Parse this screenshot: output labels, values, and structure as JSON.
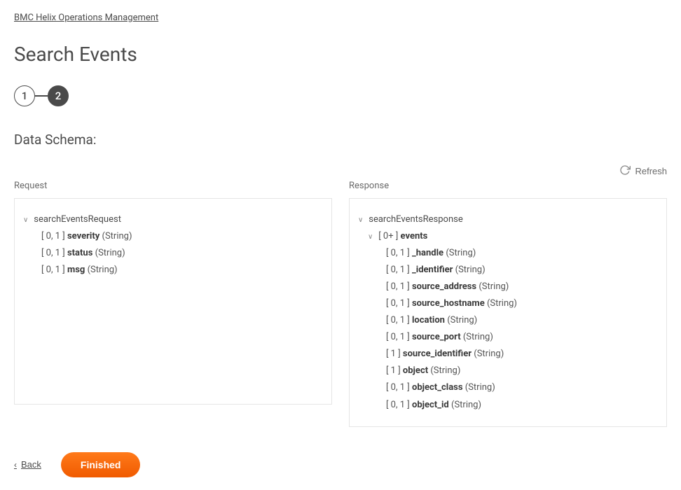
{
  "breadcrumb": "BMC Helix Operations Management",
  "page_title": "Search Events",
  "stepper": {
    "step1": "1",
    "step2": "2"
  },
  "section_heading": "Data Schema:",
  "refresh_label": "Refresh",
  "columns": {
    "request": {
      "label": "Request",
      "root": "searchEventsRequest",
      "fields": [
        {
          "card": "[ 0, 1 ]",
          "name": "severity",
          "type": "(String)"
        },
        {
          "card": "[ 0, 1 ]",
          "name": "status",
          "type": "(String)"
        },
        {
          "card": "[ 0, 1 ]",
          "name": "msg",
          "type": "(String)"
        }
      ]
    },
    "response": {
      "label": "Response",
      "root": "searchEventsResponse",
      "events_card": "[ 0+ ]",
      "events_name": "events",
      "fields": [
        {
          "card": "[ 0, 1 ]",
          "name": "_handle",
          "type": "(String)"
        },
        {
          "card": "[ 0, 1 ]",
          "name": "_identifier",
          "type": "(String)"
        },
        {
          "card": "[ 0, 1 ]",
          "name": "source_address",
          "type": "(String)"
        },
        {
          "card": "[ 0, 1 ]",
          "name": "source_hostname",
          "type": "(String)"
        },
        {
          "card": "[ 0, 1 ]",
          "name": "location",
          "type": "(String)"
        },
        {
          "card": "[ 0, 1 ]",
          "name": "source_port",
          "type": "(String)"
        },
        {
          "card": "[ 1 ]",
          "name": "source_identifier",
          "type": "(String)"
        },
        {
          "card": "[ 1 ]",
          "name": "object",
          "type": "(String)"
        },
        {
          "card": "[ 0, 1 ]",
          "name": "object_class",
          "type": "(String)"
        },
        {
          "card": "[ 0, 1 ]",
          "name": "object_id",
          "type": "(String)"
        }
      ]
    }
  },
  "footer": {
    "back": "Back",
    "finished": "Finished"
  }
}
